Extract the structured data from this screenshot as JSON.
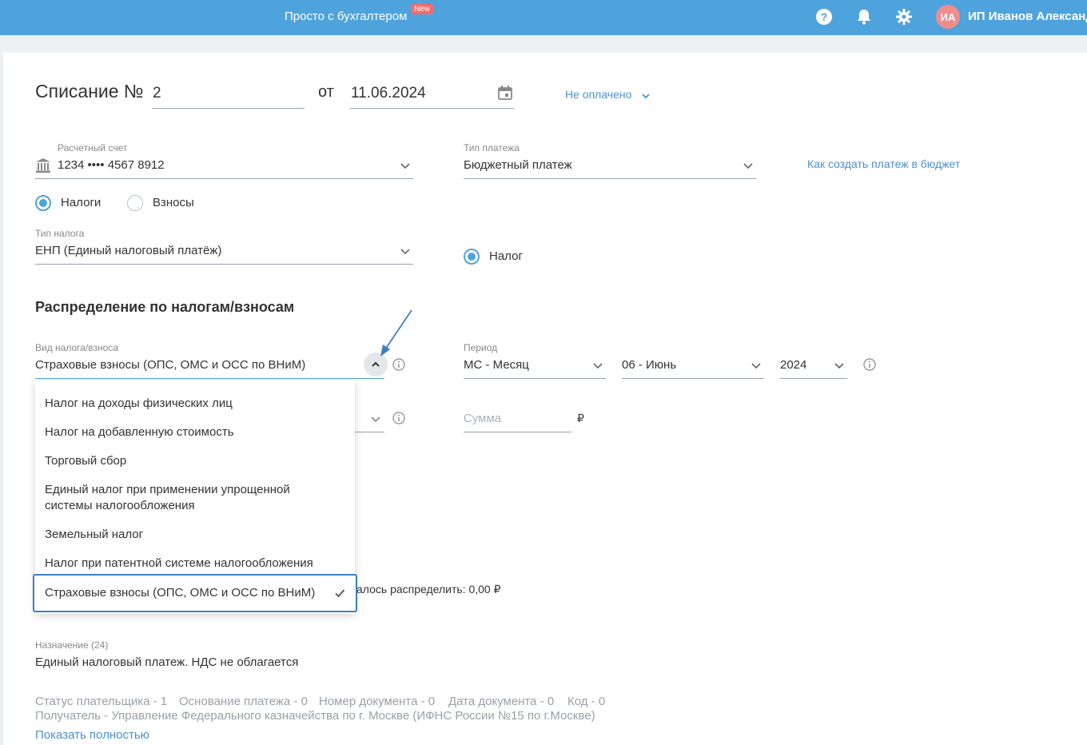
{
  "header": {
    "promo": "Просто с бухгалтером",
    "new_badge": "New",
    "avatar_initials": "ИА",
    "user_name": "ИП Иванов Александ",
    "icons": [
      "help-icon",
      "bell-icon",
      "gear-icon"
    ]
  },
  "document": {
    "title_prefix": "Списание №",
    "number": "2",
    "from_label": "от",
    "date": "11.06.2024",
    "status": "Не оплачено"
  },
  "account": {
    "label": "Расчетный счет",
    "value": "1234 •••• 4567 8912"
  },
  "payment_type": {
    "label": "Тип платежа",
    "value": "Бюджетный платеж",
    "help_link": "Как создать платеж в бюджет"
  },
  "radios": {
    "taxes": "Налоги",
    "contributions": "Взносы",
    "tax": "Налог"
  },
  "tax_type": {
    "label": "Тип налога",
    "value": "ЕНП (Единый налоговый платёж)"
  },
  "distribution": {
    "title": "Распределение по налогам/взносам",
    "kind_label": "Вид налога/взноса",
    "kind_value": "Страховые взносы (ОПС, ОМС и ОСС по ВНиМ)",
    "period_label": "Период",
    "period_value": "МС - Месяц",
    "month_value": "06 - Июнь",
    "year_value": "2024",
    "sum_placeholder": "Сумма",
    "currency": "₽",
    "remaining_text": "алось распределить: 0,00 ₽"
  },
  "dropdown": {
    "items": [
      "Налог на доходы физических лиц",
      "Налог на добавленную стоимость",
      "Торговый сбор",
      "Единый налог при применении упрощенной",
      "системы налогообложения",
      "Земельный налог",
      "Налог при патентной системе налогообложения"
    ],
    "selected": "Страховые взносы (ОПС, ОМС и ОСС по ВНиМ)"
  },
  "purpose": {
    "label": "Назначение (24)",
    "value": "Единый налоговый платеж. НДС не облагается"
  },
  "details": {
    "payer_status": "Статус плательщика - 1",
    "basis": "Основание платежа - 0",
    "doc_number": "Номер документа - 0",
    "doc_date": "Дата документа - 0",
    "code": "Код - 0",
    "recipient": "Получатель - Управление Федерального казначейства по г. Москве (ИФНС России №15 по г.Москве)",
    "show_full": "Показать полностью"
  },
  "colors": {
    "header_bg": "#4fa3dd",
    "accent": "#4fa3dd",
    "link": "#4a90cf",
    "selected_border": "#3d7fc1"
  }
}
